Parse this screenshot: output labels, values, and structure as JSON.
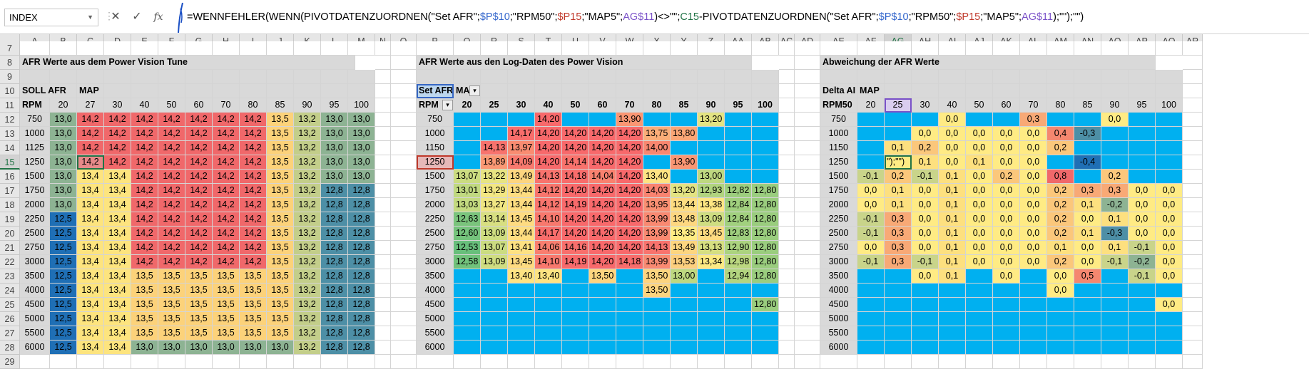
{
  "namebox": {
    "value": "INDEX"
  },
  "formula": {
    "parts": [
      {
        "t": "=WENNFEHLER(WENN(PIVOTDATENZUORDNEN(\"Set AFR\";",
        "c": "#000"
      },
      {
        "t": "$P$10",
        "c": "#3366cc"
      },
      {
        "t": ";\"RPM50\";",
        "c": "#000"
      },
      {
        "t": "$P15",
        "c": "#c0392b"
      },
      {
        "t": ";\"MAP5\";",
        "c": "#000"
      },
      {
        "t": "AG$11",
        "c": "#7a51c8"
      },
      {
        "t": ")<>\"\";",
        "c": "#000"
      },
      {
        "t": "C15",
        "c": "#217346"
      },
      {
        "t": "-PIVOTDATENZUORDNEN(\"Set AFR\";",
        "c": "#000"
      },
      {
        "t": "$P$10",
        "c": "#3366cc"
      },
      {
        "t": ";\"RPM50\";",
        "c": "#000"
      },
      {
        "t": "$P15",
        "c": "#c0392b"
      },
      {
        "t": ";\"MAP5\";",
        "c": "#000"
      },
      {
        "t": "AG$11",
        "c": "#7a51c8"
      },
      {
        "t": ");\"\");\"\")",
        "c": "#000"
      }
    ]
  },
  "columns": [
    "A",
    "B",
    "C",
    "D",
    "E",
    "F",
    "G",
    "H",
    "I",
    "J",
    "K",
    "L",
    "M",
    "N",
    "O",
    "P",
    "Q",
    "R",
    "S",
    "T",
    "U",
    "V",
    "W",
    "X",
    "Y",
    "Z",
    "AA",
    "AB",
    "AC",
    "AD",
    "AE",
    "AF",
    "AG",
    "AH",
    "AI",
    "AJ",
    "AK",
    "AL",
    "AM",
    "AN",
    "AO",
    "AP",
    "AQ",
    "AR"
  ],
  "rows": [
    "7",
    "8",
    "9",
    "10",
    "11",
    "12",
    "13",
    "14",
    "15",
    "16",
    "17",
    "18",
    "19",
    "20",
    "21",
    "22",
    "23",
    "24",
    "25",
    "26",
    "27",
    "28",
    "29"
  ],
  "titles": {
    "t1": "AFR Werte aus dem Power Vision Tune",
    "t2": "AFR Werte aus den Log-Daten des Power Vision",
    "t3": "Abweichung der AFR Werte"
  },
  "section1": {
    "label_soll": "SOLL AFR",
    "label_map": "MAP",
    "label_rpm": "RPM",
    "maps": [
      "20",
      "27",
      "30",
      "40",
      "50",
      "60",
      "70",
      "80",
      "85",
      "90",
      "95",
      "100"
    ],
    "rpms": [
      "750",
      "1000",
      "1125",
      "1250",
      "1500",
      "1750",
      "2000",
      "2250",
      "2500",
      "2750",
      "3000",
      "3500",
      "4000",
      "4500",
      "5000",
      "5500",
      "6000"
    ],
    "values": [
      [
        "13,0",
        "14,2",
        "14,2",
        "14,2",
        "14,2",
        "14,2",
        "14,2",
        "14,2",
        "13,5",
        "13,2",
        "13,0",
        "13,0"
      ],
      [
        "13,0",
        "14,2",
        "14,2",
        "14,2",
        "14,2",
        "14,2",
        "14,2",
        "14,2",
        "13,5",
        "13,2",
        "13,0",
        "13,0"
      ],
      [
        "13,0",
        "14,2",
        "14,2",
        "14,2",
        "14,2",
        "14,2",
        "14,2",
        "14,2",
        "13,5",
        "13,2",
        "13,0",
        "13,0"
      ],
      [
        "13,0",
        "14,2",
        "14,2",
        "14,2",
        "14,2",
        "14,2",
        "14,2",
        "14,2",
        "13,5",
        "13,2",
        "13,0",
        "13,0"
      ],
      [
        "13,0",
        "13,4",
        "13,4",
        "14,2",
        "14,2",
        "14,2",
        "14,2",
        "14,2",
        "13,5",
        "13,2",
        "13,0",
        "13,0"
      ],
      [
        "13,0",
        "13,4",
        "13,4",
        "14,2",
        "14,2",
        "14,2",
        "14,2",
        "14,2",
        "13,5",
        "13,2",
        "12,8",
        "12,8"
      ],
      [
        "13,0",
        "13,4",
        "13,4",
        "14,2",
        "14,2",
        "14,2",
        "14,2",
        "14,2",
        "13,5",
        "13,2",
        "12,8",
        "12,8"
      ],
      [
        "12,5",
        "13,4",
        "13,4",
        "14,2",
        "14,2",
        "14,2",
        "14,2",
        "14,2",
        "13,5",
        "13,2",
        "12,8",
        "12,8"
      ],
      [
        "12,5",
        "13,4",
        "13,4",
        "14,2",
        "14,2",
        "14,2",
        "14,2",
        "14,2",
        "13,5",
        "13,2",
        "12,8",
        "12,8"
      ],
      [
        "12,5",
        "13,4",
        "13,4",
        "14,2",
        "14,2",
        "14,2",
        "14,2",
        "14,2",
        "13,5",
        "13,2",
        "12,8",
        "12,8"
      ],
      [
        "12,5",
        "13,4",
        "13,4",
        "14,2",
        "14,2",
        "14,2",
        "14,2",
        "14,2",
        "13,5",
        "13,2",
        "12,8",
        "12,8"
      ],
      [
        "12,5",
        "13,4",
        "13,4",
        "13,5",
        "13,5",
        "13,5",
        "13,5",
        "13,5",
        "13,5",
        "13,2",
        "12,8",
        "12,8"
      ],
      [
        "12,5",
        "13,4",
        "13,4",
        "13,5",
        "13,5",
        "13,5",
        "13,5",
        "13,5",
        "13,5",
        "13,2",
        "12,8",
        "12,8"
      ],
      [
        "12,5",
        "13,4",
        "13,4",
        "13,5",
        "13,5",
        "13,5",
        "13,5",
        "13,5",
        "13,5",
        "13,2",
        "12,8",
        "12,8"
      ],
      [
        "12,5",
        "13,4",
        "13,4",
        "13,5",
        "13,5",
        "13,5",
        "13,5",
        "13,5",
        "13,5",
        "13,2",
        "12,8",
        "12,8"
      ],
      [
        "12,5",
        "13,4",
        "13,4",
        "13,5",
        "13,5",
        "13,5",
        "13,5",
        "13,5",
        "13,5",
        "13,2",
        "12,8",
        "12,8"
      ],
      [
        "12,5",
        "13,4",
        "13,4",
        "13,0",
        "13,0",
        "13,0",
        "13,0",
        "13,0",
        "13,0",
        "13,2",
        "12,8",
        "12,8"
      ]
    ]
  },
  "section2": {
    "label_set": "Set AFR",
    "label_map": "MAP",
    "label_rpm": "RPM",
    "maps": [
      "20",
      "25",
      "30",
      "40",
      "50",
      "60",
      "70",
      "80",
      "85",
      "90",
      "95",
      "100"
    ],
    "rpms": [
      "750",
      "1000",
      "1150",
      "1250",
      "1500",
      "1750",
      "2000",
      "2250",
      "2500",
      "2750",
      "3000",
      "3500",
      "4000",
      "4500",
      "5000",
      "5500",
      "6000"
    ],
    "values": [
      [
        "",
        "",
        "",
        "14,20",
        "",
        "",
        "13,90",
        "",
        "",
        "13,20",
        "",
        ""
      ],
      [
        "",
        "",
        "14,17",
        "14,20",
        "14,20",
        "14,20",
        "14,20",
        "13,75",
        "13,80",
        "",
        "",
        ""
      ],
      [
        "",
        "14,13",
        "13,97",
        "14,20",
        "14,20",
        "14,20",
        "14,20",
        "14,00",
        "",
        "",
        "",
        ""
      ],
      [
        "",
        "13,89",
        "14,09",
        "14,20",
        "14,14",
        "14,20",
        "14,20",
        "",
        "13,90",
        "",
        "",
        ""
      ],
      [
        "13,07",
        "13,22",
        "13,49",
        "14,13",
        "14,18",
        "14,04",
        "14,20",
        "13,40",
        "",
        "13,00",
        "",
        ""
      ],
      [
        "13,01",
        "13,29",
        "13,44",
        "14,12",
        "14,20",
        "14,20",
        "14,20",
        "14,03",
        "13,20",
        "12,93",
        "12,82",
        "12,80"
      ],
      [
        "13,03",
        "13,27",
        "13,44",
        "14,12",
        "14,19",
        "14,20",
        "14,20",
        "13,95",
        "13,44",
        "13,38",
        "12,84",
        "12,80"
      ],
      [
        "12,63",
        "13,14",
        "13,45",
        "14,10",
        "14,20",
        "14,20",
        "14,20",
        "13,99",
        "13,48",
        "13,09",
        "12,84",
        "12,80"
      ],
      [
        "12,60",
        "13,09",
        "13,44",
        "14,17",
        "14,20",
        "14,20",
        "14,20",
        "13,99",
        "13,35",
        "13,45",
        "12,83",
        "12,80"
      ],
      [
        "12,53",
        "13,07",
        "13,41",
        "14,06",
        "14,16",
        "14,20",
        "14,20",
        "14,13",
        "13,49",
        "13,13",
        "12,90",
        "12,80"
      ],
      [
        "12,58",
        "13,09",
        "13,45",
        "14,10",
        "14,19",
        "14,20",
        "14,18",
        "13,99",
        "13,53",
        "13,34",
        "12,98",
        "12,80"
      ],
      [
        "",
        "",
        "13,40",
        "13,40",
        "",
        "13,50",
        "",
        "13,50",
        "13,00",
        "",
        "12,94",
        "12,80"
      ],
      [
        "",
        "",
        "",
        "",
        "",
        "",
        "",
        "13,50",
        "",
        "",
        "",
        ""
      ],
      [
        "",
        "",
        "",
        "",
        "",
        "",
        "",
        "",
        "",
        "",
        "",
        "12,80"
      ],
      [
        "",
        "",
        "",
        "",
        "",
        "",
        "",
        "",
        "",
        "",
        "",
        ""
      ],
      [
        "",
        "",
        "",
        "",
        "",
        "",
        "",
        "",
        "",
        "",
        "",
        ""
      ],
      [
        "",
        "",
        "",
        "",
        "",
        "",
        "",
        "",
        "",
        "",
        "",
        ""
      ]
    ]
  },
  "section3": {
    "label_delta": "Delta AI",
    "label_map": "MAP",
    "label_rpm": "RPM50",
    "maps": [
      "20",
      "25",
      "30",
      "40",
      "50",
      "60",
      "70",
      "80",
      "85",
      "90",
      "95",
      "100"
    ],
    "rpms": [
      "750",
      "1000",
      "1150",
      "1250",
      "1500",
      "1750",
      "2000",
      "2250",
      "2500",
      "2750",
      "3000",
      "3500",
      "4000",
      "4500",
      "5000",
      "5500",
      "6000"
    ],
    "values": [
      [
        "",
        "",
        "",
        "0,0",
        "",
        "",
        "0,3",
        "",
        "",
        "0,0",
        "",
        ""
      ],
      [
        "",
        "",
        "0,0",
        "0,0",
        "0,0",
        "0,0",
        "0,0",
        "0,4",
        "-0,3",
        "",
        "",
        ""
      ],
      [
        "",
        "0,1",
        "0,2",
        "0,0",
        "0,0",
        "0,0",
        "0,0",
        "0,2",
        "",
        "",
        "",
        ""
      ],
      [
        "",
        "\");\"\")",
        "0,1",
        "0,0",
        "0,1",
        "0,0",
        "0,0",
        "",
        "-0,4",
        "",
        "",
        ""
      ],
      [
        "-0,1",
        "0,2",
        "-0,1",
        "0,1",
        "0,0",
        "0,2",
        "0,0",
        "0,8",
        "",
        "0,2",
        "",
        ""
      ],
      [
        "0,0",
        "0,1",
        "0,0",
        "0,1",
        "0,0",
        "0,0",
        "0,0",
        "0,2",
        "0,3",
        "0,3",
        "0,0",
        "0,0"
      ],
      [
        "0,0",
        "0,1",
        "0,0",
        "0,1",
        "0,0",
        "0,0",
        "0,0",
        "0,2",
        "0,1",
        "-0,2",
        "0,0",
        "0,0"
      ],
      [
        "-0,1",
        "0,3",
        "0,0",
        "0,1",
        "0,0",
        "0,0",
        "0,0",
        "0,2",
        "0,0",
        "0,1",
        "0,0",
        "0,0"
      ],
      [
        "-0,1",
        "0,3",
        "0,0",
        "0,1",
        "0,0",
        "0,0",
        "0,0",
        "0,2",
        "0,1",
        "-0,3",
        "0,0",
        "0,0"
      ],
      [
        "0,0",
        "0,3",
        "0,0",
        "0,1",
        "0,0",
        "0,0",
        "0,0",
        "0,1",
        "0,0",
        "0,1",
        "-0,1",
        "0,0"
      ],
      [
        "-0,1",
        "0,3",
        "-0,1",
        "0,1",
        "0,0",
        "0,0",
        "0,0",
        "0,2",
        "0,0",
        "-0,1",
        "-0,2",
        "0,0"
      ],
      [
        "",
        "",
        "0,0",
        "0,1",
        "",
        "0,0",
        "",
        "0,0",
        "0,5",
        "",
        "-0,1",
        "0,0"
      ],
      [
        "",
        "",
        "",
        "",
        "",
        "",
        "",
        "0,0",
        "",
        "",
        "",
        ""
      ],
      [
        "",
        "",
        "",
        "",
        "",
        "",
        "",
        "",
        "",
        "",
        "",
        "0,0"
      ],
      [
        "",
        "",
        "",
        "",
        "",
        "",
        "",
        "",
        "",
        "",
        "",
        ""
      ],
      [
        "",
        "",
        "",
        "",
        "",
        "",
        "",
        "",
        "",
        "",
        "",
        ""
      ],
      [
        "",
        "",
        "",
        "",
        "",
        "",
        "",
        "",
        "",
        "",
        "",
        ""
      ]
    ]
  },
  "row_label_29": ""
}
